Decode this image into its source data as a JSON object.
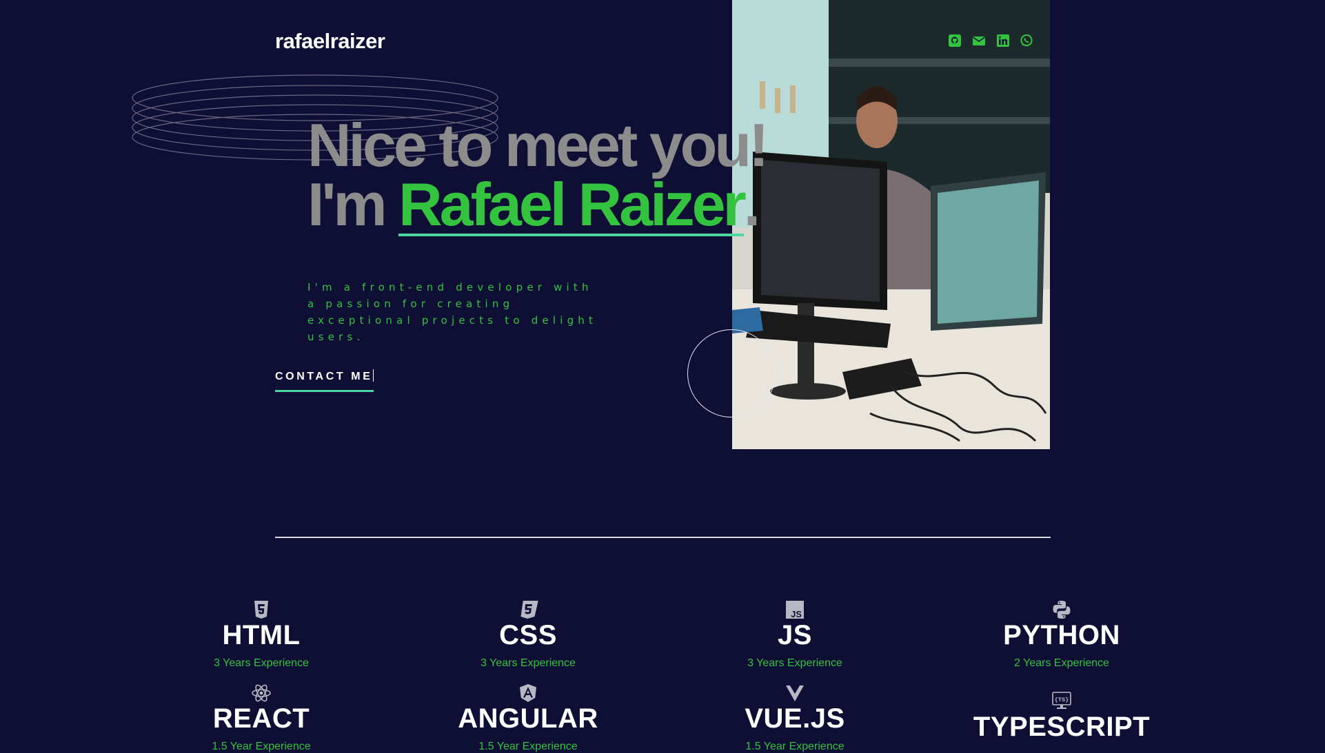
{
  "header": {
    "brand": "rafaelraizer",
    "social_icons": [
      "github-icon",
      "envelope-icon",
      "linkedin-icon",
      "whatsapp-icon"
    ],
    "accent_color": "#33c33f"
  },
  "hero": {
    "line1": "Nice to meet you!",
    "line2_prefix": "I'm ",
    "name": "Rafael Raizer",
    "period": ".",
    "tagline": "I'm a front-end developer with a passion for creating exceptional projects to delight users.",
    "cta": "CONTACT ME"
  },
  "colors": {
    "background": "#0f0f35",
    "accent_green": "#33c33f",
    "underline_teal": "#4ad6a0",
    "headline_gray": "#8c8c8c"
  },
  "skills": [
    {
      "icon": "html5-icon",
      "name": "HTML",
      "experience": "3 Years Experience"
    },
    {
      "icon": "css3-icon",
      "name": "CSS",
      "experience": "3 Years Experience"
    },
    {
      "icon": "javascript-icon",
      "name": "JS",
      "experience": "3 Years Experience"
    },
    {
      "icon": "python-icon",
      "name": "PYTHON",
      "experience": "2 Years Experience"
    },
    {
      "icon": "react-icon",
      "name": "REACT",
      "experience": "1.5 Year Experience"
    },
    {
      "icon": "angular-icon",
      "name": "ANGULAR",
      "experience": "1.5 Year Experience"
    },
    {
      "icon": "vuejs-icon",
      "name": "VUE.JS",
      "experience": "1.5 Year Experience"
    },
    {
      "icon": "typescript-icon",
      "name": "TYPESCRIPT",
      "experience": ""
    }
  ]
}
